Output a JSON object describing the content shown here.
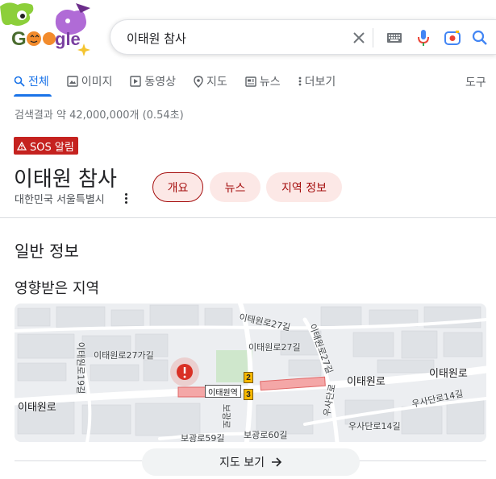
{
  "header": {
    "logo_text": "Google",
    "search": {
      "query": "이태원 참사"
    }
  },
  "tabs": [
    {
      "label": "전체",
      "icon": "search-icon",
      "active": true
    },
    {
      "label": "이미지",
      "icon": "image-icon"
    },
    {
      "label": "동영상",
      "icon": "video-icon"
    },
    {
      "label": "지도",
      "icon": "map-pin-icon"
    },
    {
      "label": "뉴스",
      "icon": "news-icon"
    },
    {
      "label": "더보기",
      "icon": "more-vert-icon"
    }
  ],
  "tools_label": "도구",
  "result_stats": "검색결과 약 42,000,000개 (0.54초)",
  "panel": {
    "sos_label": "SOS 알림",
    "title": "이태원 참사",
    "subtitle": "대한민국 서울특별시",
    "chips": [
      {
        "label": "개요",
        "selected": true
      },
      {
        "label": "뉴스"
      },
      {
        "label": "지역 정보"
      }
    ],
    "section_title": "일반 정보",
    "affected_title": "영향받은 지역",
    "map": {
      "labels": [
        "이태원로27길",
        "이태원로27가길",
        "이태원로27길",
        "이태원로27길",
        "이태원로19길",
        "이태원로",
        "이태원로",
        "이태원로",
        "보광로",
        "우사단로",
        "우사단로14길",
        "우사단로14길",
        "보광로59길",
        "보광로60길"
      ],
      "station": "이태원역",
      "line_numbers": [
        "2",
        "3"
      ]
    },
    "map_button": "지도 보기"
  },
  "colors": {
    "accent": "#1a73e8",
    "sos": "#c5221f",
    "chip_bg": "#fce8e6",
    "chip_text": "#a50e0e"
  }
}
